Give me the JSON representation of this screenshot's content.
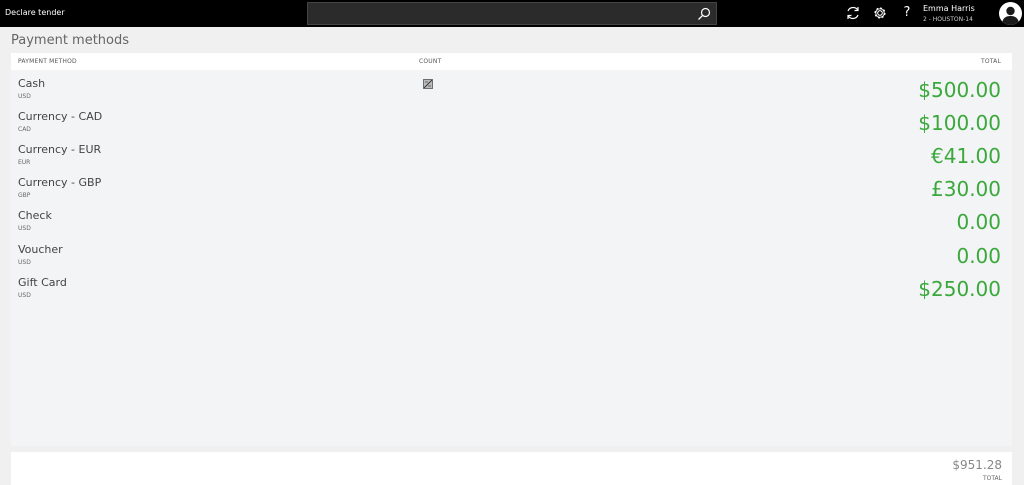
{
  "app": {
    "title": "Declare tender",
    "search": {
      "value": "",
      "placeholder": ""
    }
  },
  "user": {
    "name": "Emma Harris",
    "store": "2 - HOUSTON-14"
  },
  "toolbar": {
    "help_label": "?"
  },
  "page": {
    "title": "Payment methods"
  },
  "columns": {
    "method": "PAYMENT METHOD",
    "count": "COUNT",
    "total": "TOTAL"
  },
  "rows": [
    {
      "name": "Cash",
      "currency": "USD",
      "total": "$500.00"
    },
    {
      "name": "Currency - CAD",
      "currency": "CAD",
      "total": "$100.00"
    },
    {
      "name": "Currency - EUR",
      "currency": "EUR",
      "total": "€41.00"
    },
    {
      "name": "Currency - GBP",
      "currency": "GBP",
      "total": "£30.00"
    },
    {
      "name": "Check",
      "currency": "USD",
      "total": "0.00"
    },
    {
      "name": "Voucher",
      "currency": "USD",
      "total": "0.00"
    },
    {
      "name": "Gift Card",
      "currency": "USD",
      "total": "$250.00"
    }
  ],
  "summary": {
    "total": "$951.28",
    "label": "TOTAL"
  },
  "icons": {
    "search": "search-icon",
    "refresh": "refresh-icon",
    "settings": "gear-icon",
    "help": "help-icon",
    "avatar": "avatar",
    "count": "count-calculator-icon"
  },
  "colors": {
    "topbar": "#000000",
    "accent_total": "#3aa83a",
    "grid_background": "#f3f4f6"
  }
}
